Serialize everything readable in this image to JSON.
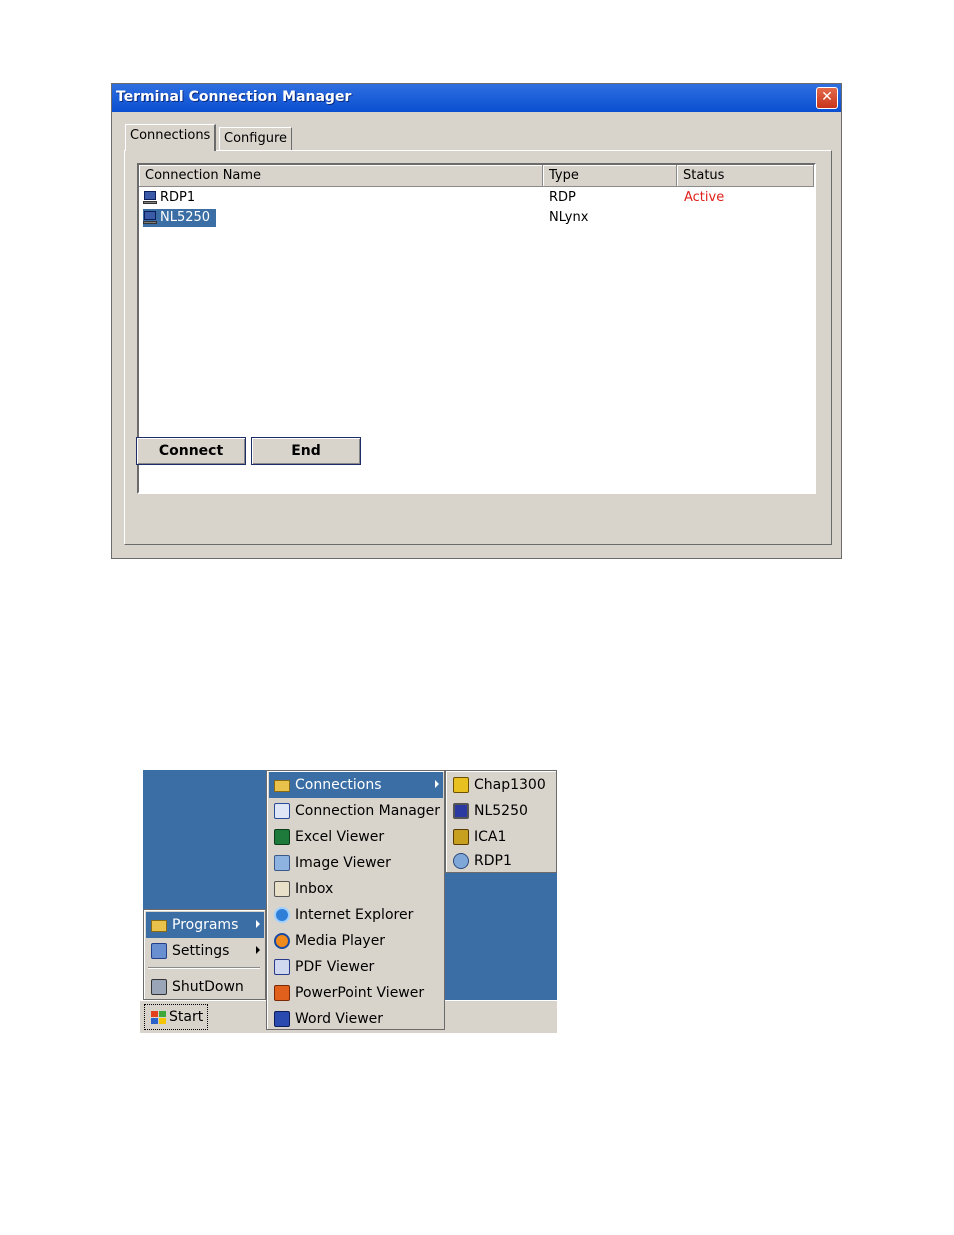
{
  "window": {
    "title": "Terminal Connection Manager",
    "close_glyph": "✕",
    "tabs": [
      {
        "label": "Connections",
        "active": true
      },
      {
        "label": "Configure",
        "active": false
      }
    ],
    "list": {
      "columns": [
        "Connection Name",
        "Type",
        "Status"
      ],
      "rows": [
        {
          "name": "RDP1",
          "type": "RDP",
          "status": "Active",
          "selected": false,
          "icon": "computer-icon"
        },
        {
          "name": "NL5250",
          "type": "NLynx",
          "status": "",
          "selected": true,
          "icon": "computer-icon"
        }
      ]
    },
    "buttons": {
      "connect_label": "Connect",
      "end_label": "End"
    }
  },
  "start_menu": {
    "start_label": "Start",
    "main_items": [
      {
        "label": "Programs",
        "icon": "programs-icon",
        "submenu": true,
        "highlighted": true
      },
      {
        "label": "Settings",
        "icon": "settings-icon",
        "submenu": true,
        "highlighted": false
      },
      {
        "label": "ShutDown",
        "icon": "shutdown-icon",
        "submenu": false,
        "highlighted": false
      }
    ],
    "programs_items": [
      {
        "label": "Connections",
        "icon": "folder-icon",
        "submenu": true,
        "highlighted": true
      },
      {
        "label": "Connection Manager",
        "icon": "connection-manager-icon"
      },
      {
        "label": "Excel Viewer",
        "icon": "excel-icon"
      },
      {
        "label": "Image Viewer",
        "icon": "image-viewer-icon"
      },
      {
        "label": "Inbox",
        "icon": "inbox-icon"
      },
      {
        "label": "Internet Explorer",
        "icon": "internet-explorer-icon"
      },
      {
        "label": "Media Player",
        "icon": "media-player-icon"
      },
      {
        "label": "PDF Viewer",
        "icon": "pdf-icon"
      },
      {
        "label": "PowerPoint Viewer",
        "icon": "powerpoint-icon"
      },
      {
        "label": "Word Viewer",
        "icon": "word-icon"
      }
    ],
    "connections_items": [
      {
        "label": "Chap1300",
        "icon": "chap-icon"
      },
      {
        "label": "NL5250",
        "icon": "monitor-icon"
      },
      {
        "label": "ICA1",
        "icon": "ica-icon"
      },
      {
        "label": "RDP1",
        "icon": "rdp-icon"
      }
    ]
  },
  "colors": {
    "titlebar": "#0a4fd1",
    "selection": "#3a6ea5",
    "status_active": "#e0201a",
    "face": "#d8d4cc"
  }
}
